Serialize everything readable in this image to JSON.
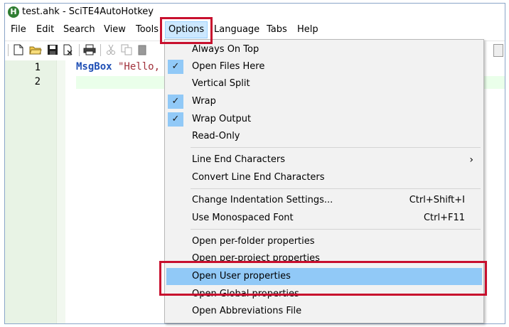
{
  "window": {
    "title": "test.ahk - SciTE4AutoHotkey",
    "icon": "autohotkey-app-icon",
    "icon_glyph": "H"
  },
  "menubar": {
    "items": [
      "File",
      "Edit",
      "Search",
      "View",
      "Tools",
      "Options",
      "Language",
      "Tabs",
      "Help"
    ],
    "active": "Options"
  },
  "toolbar": {
    "icons": [
      "new-file-icon",
      "open-folder-icon",
      "save-icon",
      "close-file-icon",
      "print-icon",
      "cut-icon",
      "copy-icon",
      "paste-icon"
    ]
  },
  "editor": {
    "lines": [
      {
        "number": "1",
        "keyword": "MsgBox",
        "text": " \"Hello,"
      },
      {
        "number": "2",
        "keyword": "",
        "text": ""
      }
    ]
  },
  "options_menu": {
    "items": [
      {
        "label": "Always On Top",
        "checked": false
      },
      {
        "label": "Open Files Here",
        "checked": true
      },
      {
        "label": "Vertical Split",
        "checked": false
      },
      {
        "label": "Wrap",
        "checked": true
      },
      {
        "label": "Wrap Output",
        "checked": true
      },
      {
        "label": "Read-Only",
        "checked": false
      },
      {
        "label": "Line End Characters",
        "submenu": true
      },
      {
        "label": "Convert Line End Characters"
      },
      {
        "label": "Change Indentation Settings...",
        "shortcut": "Ctrl+Shift+I"
      },
      {
        "label": "Use Monospaced Font",
        "shortcut": "Ctrl+F11"
      },
      {
        "label": "Open per-folder properties"
      },
      {
        "label": "Open per-project properties"
      },
      {
        "label": "Open User properties",
        "highlighted": true
      },
      {
        "label": "Open Global properties"
      },
      {
        "label": "Open Abbreviations File"
      }
    ],
    "check_glyph": "✓",
    "submenu_glyph": "›"
  },
  "colors": {
    "highlight": "#91c9f7",
    "annotation_red": "#c8102e",
    "gutter": "#e8f3e5",
    "keyword": "#1f4fb5",
    "string": "#a0303a"
  }
}
